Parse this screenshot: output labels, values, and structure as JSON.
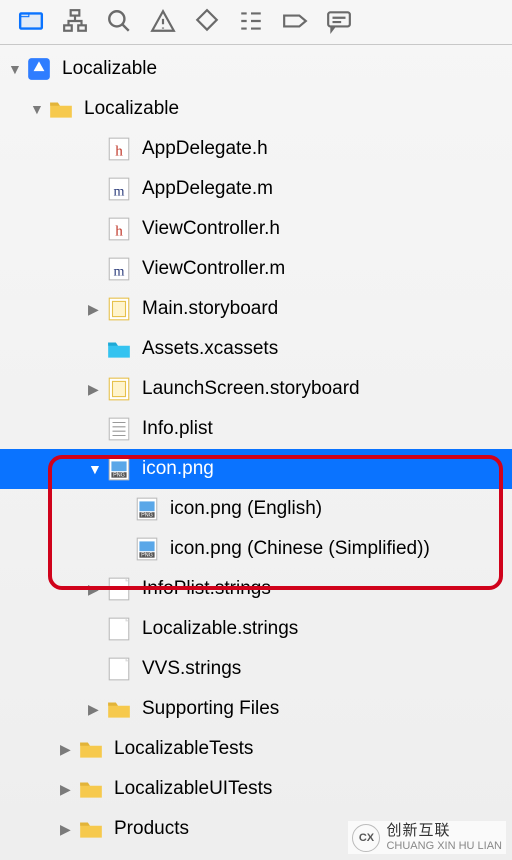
{
  "toolbar": {
    "icons": [
      "folder",
      "source-control",
      "search",
      "warning",
      "ribbon",
      "list",
      "tag",
      "comment"
    ]
  },
  "tree": {
    "root": {
      "label": "Localizable",
      "icon": "xcode-project",
      "expanded": true,
      "selected": false
    },
    "folder": {
      "label": "Localizable",
      "icon": "folder-yellow",
      "expanded": true
    },
    "items": [
      {
        "label": "AppDelegate.h",
        "icon": "h-file",
        "arrow": "none"
      },
      {
        "label": "AppDelegate.m",
        "icon": "m-file",
        "arrow": "none"
      },
      {
        "label": "ViewController.h",
        "icon": "h-file",
        "arrow": "none"
      },
      {
        "label": "ViewController.m",
        "icon": "m-file",
        "arrow": "none"
      },
      {
        "label": "Main.storyboard",
        "icon": "storyboard",
        "arrow": "right"
      },
      {
        "label": "Assets.xcassets",
        "icon": "xcassets",
        "arrow": "none"
      },
      {
        "label": "LaunchScreen.storyboard",
        "icon": "storyboard",
        "arrow": "right"
      },
      {
        "label": "Info.plist",
        "icon": "plist",
        "arrow": "none"
      },
      {
        "label": "icon.png",
        "icon": "png",
        "arrow": "down",
        "selected": true
      },
      {
        "label": "icon.png (English)",
        "icon": "png",
        "arrow": "none",
        "child": true
      },
      {
        "label": "icon.png (Chinese (Simplified))",
        "icon": "png",
        "arrow": "none",
        "child": true
      },
      {
        "label": "InfoPlist.strings",
        "icon": "strings",
        "arrow": "right"
      },
      {
        "label": "Localizable.strings",
        "icon": "strings",
        "arrow": "none"
      },
      {
        "label": "VVS.strings",
        "icon": "strings",
        "arrow": "none"
      },
      {
        "label": "Supporting Files",
        "icon": "folder-yellow",
        "arrow": "right"
      }
    ],
    "groups": [
      {
        "label": "LocalizableTests",
        "icon": "folder-yellow"
      },
      {
        "label": "LocalizableUITests",
        "icon": "folder-yellow"
      },
      {
        "label": "Products",
        "icon": "folder-yellow"
      }
    ]
  },
  "watermark": {
    "brand": "创新互联",
    "sub": "CHUANG XIN HU LIAN"
  }
}
